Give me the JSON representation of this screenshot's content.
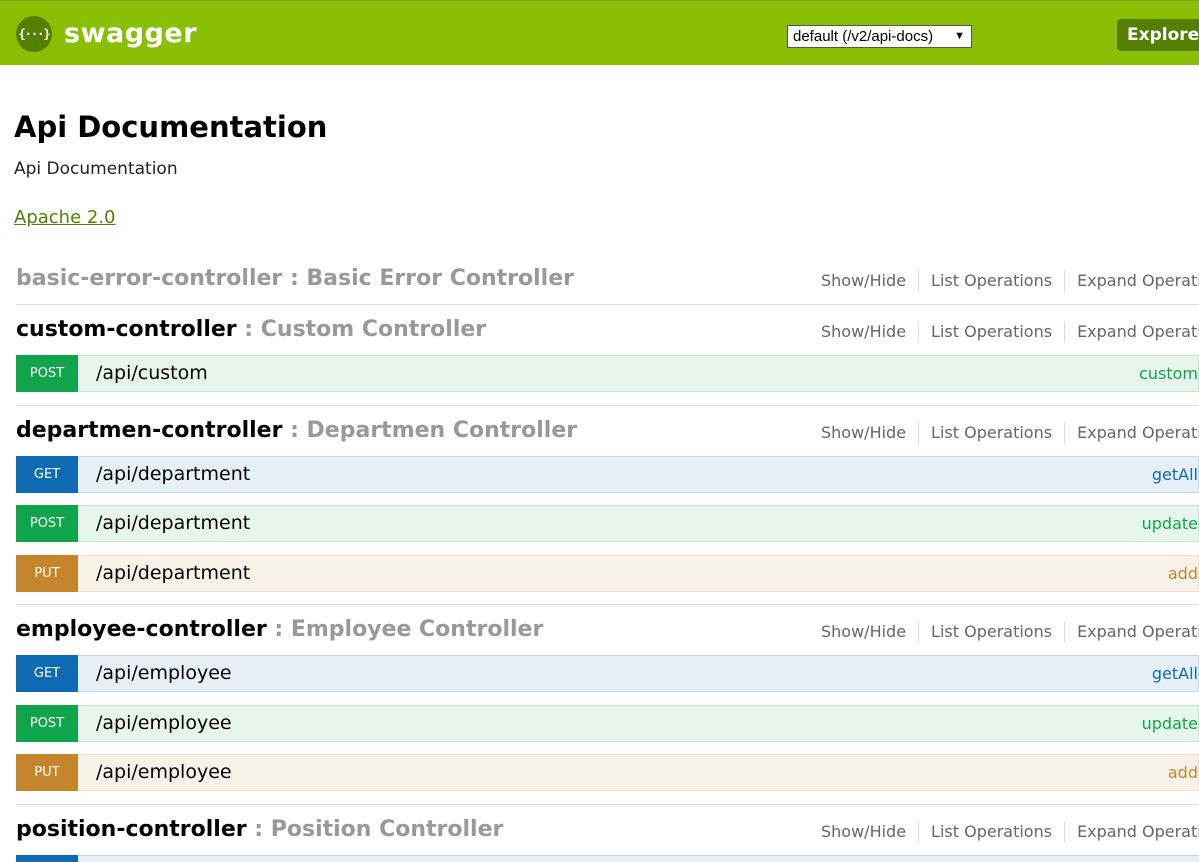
{
  "header": {
    "logo_icon_text": "{···}",
    "logo_text": "swagger",
    "api_selector_value": "default (/v2/api-docs)",
    "api_selector_caret": "▼",
    "explore_label": "Explore",
    "colors": {
      "bar": "#89bf04",
      "dark": "#547f00"
    }
  },
  "info": {
    "title": "Api Documentation",
    "description": "Api Documentation",
    "license": "Apache 2.0"
  },
  "resource_links": {
    "show_hide": "Show/Hide",
    "list_operations": "List Operations",
    "expand_operations": "Expand Operations"
  },
  "resources": [
    {
      "name": "basic-error-controller",
      "sep": " : ",
      "description": "Basic Error Controller",
      "operations": []
    },
    {
      "name": "custom-controller",
      "sep": " : ",
      "description": "Custom Controller",
      "operations": [
        {
          "method": "POST",
          "path": "/api/custom",
          "summary": "custom"
        }
      ]
    },
    {
      "name": "departmen-controller",
      "sep": " : ",
      "description": "Departmen Controller",
      "operations": [
        {
          "method": "GET",
          "path": "/api/department",
          "summary": "getAll"
        },
        {
          "method": "POST",
          "path": "/api/department",
          "summary": "update"
        },
        {
          "method": "PUT",
          "path": "/api/department",
          "summary": "add"
        }
      ]
    },
    {
      "name": "employee-controller",
      "sep": " : ",
      "description": "Employee Controller",
      "operations": [
        {
          "method": "GET",
          "path": "/api/employee",
          "summary": "getAll"
        },
        {
          "method": "POST",
          "path": "/api/employee",
          "summary": "update"
        },
        {
          "method": "PUT",
          "path": "/api/employee",
          "summary": "add"
        }
      ]
    },
    {
      "name": "position-controller",
      "sep": " : ",
      "description": "Position Controller",
      "operations": []
    }
  ],
  "method_colors": {
    "GET": "#0f6ab4",
    "POST": "#10a54a",
    "PUT": "#c5862b"
  }
}
